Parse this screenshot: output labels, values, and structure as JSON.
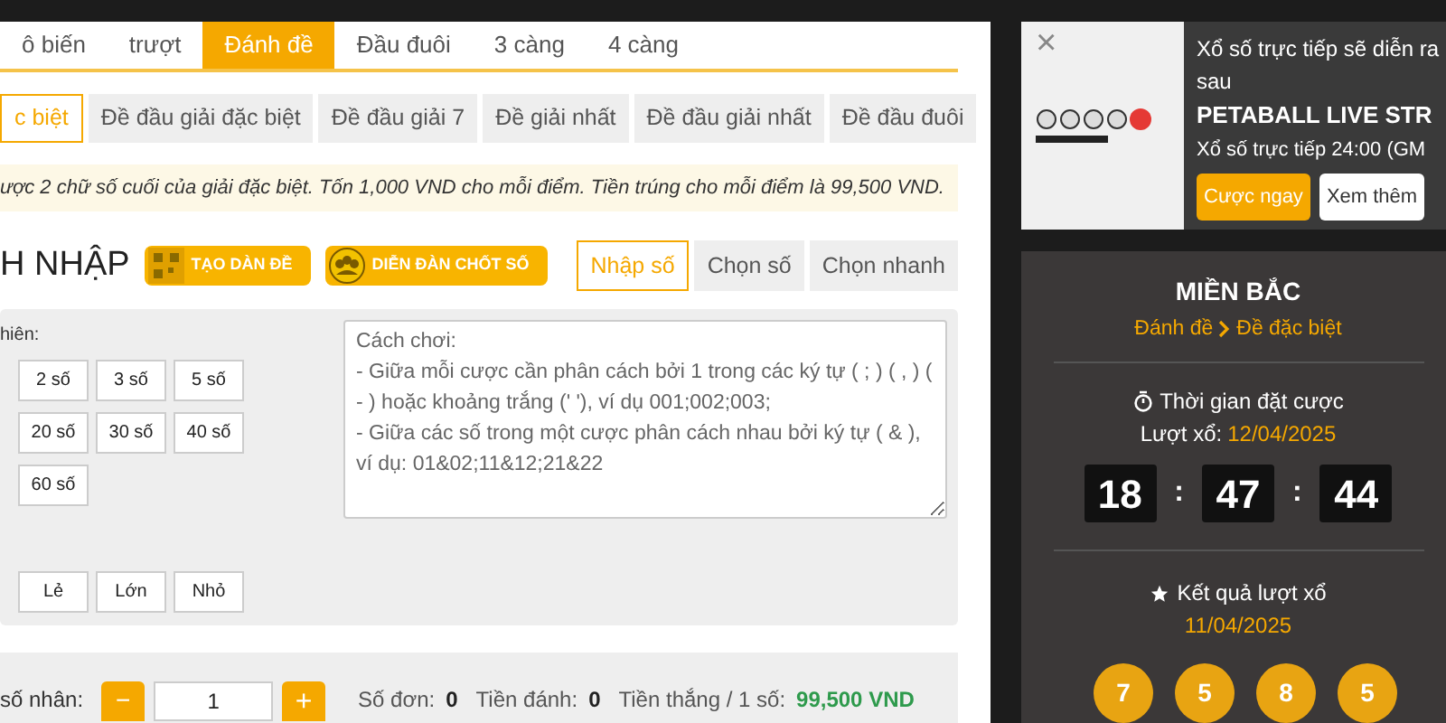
{
  "game_tabs": [
    {
      "label": "ô biến",
      "selected": false
    },
    {
      "label": "trượt",
      "selected": false
    },
    {
      "label": "Đánh đề",
      "selected": true
    },
    {
      "label": "Đầu đuôi",
      "selected": false
    },
    {
      "label": "3 càng",
      "selected": false
    },
    {
      "label": "4 càng",
      "selected": false
    }
  ],
  "bet_types": [
    {
      "label": "c biệt",
      "selected": true
    },
    {
      "label": "Đề đầu giải đặc biệt",
      "selected": false
    },
    {
      "label": "Đề đầu giải 7",
      "selected": false
    },
    {
      "label": "Đề giải nhất",
      "selected": false
    },
    {
      "label": "Đề đầu giải nhất",
      "selected": false
    },
    {
      "label": "Đề đầu đuôi",
      "selected": false
    }
  ],
  "notice": "ược 2 chữ số cuối của giải đặc biệt. Tốn 1,000 VND cho mỗi điểm. Tiền trúng cho mỗi điểm là 99,500 VND.",
  "section_title": "H NHẬP",
  "promo_buttons": [
    {
      "kind": "qr",
      "label": "TẠO DÀN ĐỀ"
    },
    {
      "kind": "people",
      "label": "DIỄN ĐÀN CHỐT SỐ"
    }
  ],
  "input_modes": [
    {
      "label": "Nhập số",
      "selected": true
    },
    {
      "label": "Chọn số",
      "selected": false
    },
    {
      "label": "Chọn nhanh",
      "selected": false
    }
  ],
  "random_label": "hiên:",
  "random_rows": [
    [
      "2 số",
      "3 số",
      "5 số"
    ],
    [
      "20 số",
      "30 số",
      "40 số"
    ],
    [
      "60 số"
    ]
  ],
  "filter_buttons": [
    "Lẻ",
    "Lớn",
    "Nhỏ"
  ],
  "instructions": {
    "value": "Cách chơi:\n- Giữa mỗi cược cần phân cách bởi 1 trong các ký tự ( ; ) ( , ) ( - ) hoặc khoảng trắng (' '), ví dụ 001;002;003;\n- Giữa các số trong một cược phân cách nhau bởi ký tự ( & ), ví dụ: 01&02;11&12;21&22"
  },
  "multiplier": {
    "label": "số nhân:",
    "minus": "−",
    "value": "1",
    "plus": "+"
  },
  "summary": [
    {
      "label": "Số đơn:",
      "value": "0",
      "kind": "plain"
    },
    {
      "label": "Tiền đánh:",
      "value": "0",
      "kind": "plain"
    },
    {
      "label": "Tiền thắng / 1 số:",
      "value": "99,500 VND",
      "kind": "money"
    }
  ],
  "promo": {
    "close": "×",
    "text": "Xổ số trực tiếp sẽ diễn ra sau",
    "title": "PETABALL LIVE STR",
    "subtitle": "Xổ số trực tiếp 24:00 (GM",
    "buttons": [
      {
        "label": "Cược ngay",
        "kind": "primary"
      },
      {
        "label": "Xem thêm",
        "kind": "secondary"
      }
    ]
  },
  "draw_panel": {
    "region": "MIỀN BẮC",
    "breadcrumb": [
      "Đánh đề",
      "Đề đặc biệt"
    ],
    "countdown_title": "Thời gian đặt cược",
    "draw_label": "Lượt xổ:",
    "draw_date": "12/04/2025",
    "countdown": [
      "18",
      "47",
      "44"
    ],
    "separator": ":",
    "results_title": "Kết quả lượt xổ",
    "results_date": "11/04/2025",
    "balls": [
      "7",
      "5",
      "8",
      "5"
    ]
  }
}
